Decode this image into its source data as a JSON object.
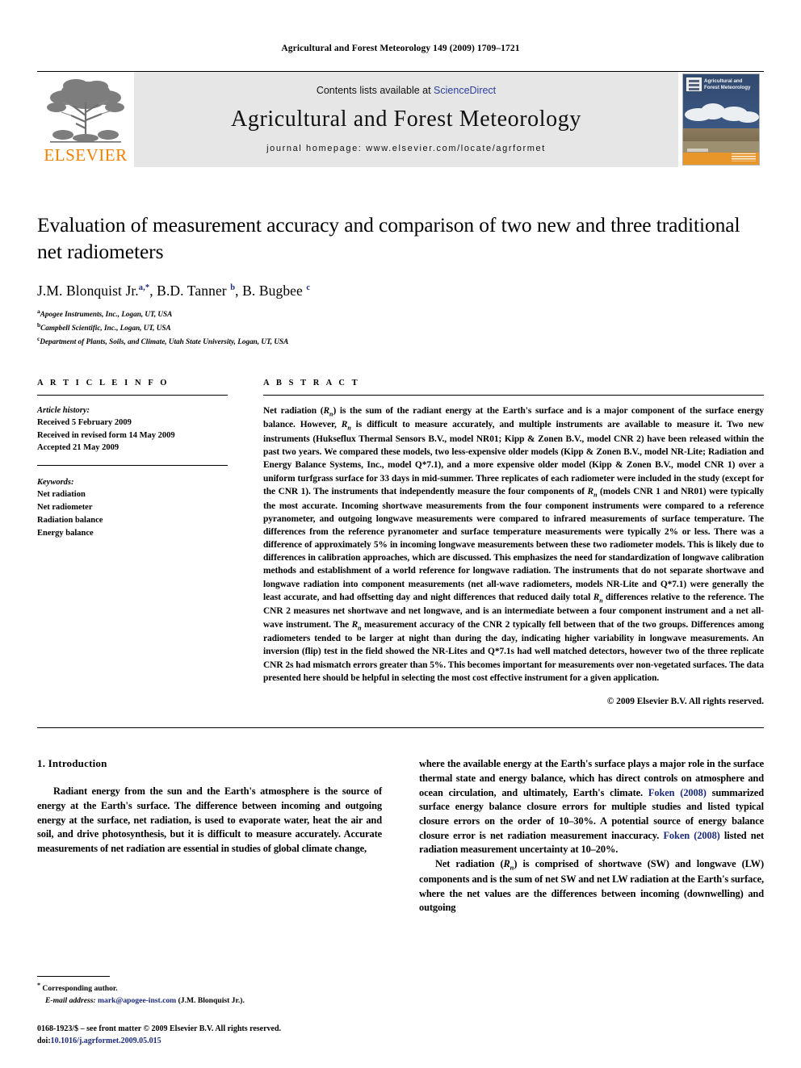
{
  "running_head": "Agricultural and Forest Meteorology 149 (2009) 1709–1721",
  "banner": {
    "publisher_name": "ELSEVIER",
    "contents_prefix": "Contents lists available at ",
    "contents_link": "ScienceDirect",
    "journal_title": "Agricultural and Forest Meteorology",
    "homepage_line": "journal homepage: www.elsevier.com/locate/agrformet",
    "cover_title": "Agricultural and Forest Meteorology"
  },
  "article": {
    "title": "Evaluation of measurement accuracy and comparison of two new and three traditional net radiometers",
    "authors_html": "J.M. Blonquist Jr.<sup>a,*</sup>, B.D. Tanner <sup>b</sup>, B. Bugbee <sup>c</sup>",
    "affiliations": [
      "Apogee Instruments, Inc., Logan, UT, USA",
      "Campbell Scientific, Inc., Logan, UT, USA",
      "Department of Plants, Soils, and Climate, Utah State University, Logan, UT, USA"
    ],
    "affiliation_marks": [
      "a",
      "b",
      "c"
    ]
  },
  "info": {
    "heading": "A R T I C L E  I N F O",
    "history_label": "Article history:",
    "history": [
      "Received 5 February 2009",
      "Received in revised form 14 May 2009",
      "Accepted 21 May 2009"
    ],
    "keywords_label": "Keywords:",
    "keywords": [
      "Net radiation",
      "Net radiometer",
      "Radiation balance",
      "Energy balance"
    ]
  },
  "abstract": {
    "heading": "A B S T R A C T",
    "text_html": "Net radiation (<i>R<sub>n</sub></i>) is the sum of the radiant energy at the Earth's surface and is a major component of the surface energy balance. However, <i>R<sub>n</sub></i> is difficult to measure accurately, and multiple instruments are available to measure it. Two new instruments (Hukseflux Thermal Sensors B.V., model NR01; Kipp &amp; Zonen B.V., model CNR 2) have been released within the past two years. We compared these models, two less-expensive older models (Kipp &amp; Zonen B.V., model NR-Lite; Radiation and Energy Balance Systems, Inc., model Q*7.1), and a more expensive older model (Kipp &amp; Zonen B.V., model CNR 1) over a uniform turfgrass surface for 33 days in mid-summer. Three replicates of each radiometer were included in the study (except for the CNR 1). The instruments that independently measure the four components of <i>R<sub>n</sub></i> (models CNR 1 and NR01) were typically the most accurate. Incoming shortwave measurements from the four component instruments were compared to a reference pyranometer, and outgoing longwave measurements were compared to infrared measurements of surface temperature. The differences from the reference pyranometer and surface temperature measurements were typically 2% or less. There was a difference of approximately 5% in incoming longwave measurements between these two radiometer models. This is likely due to differences in calibration approaches, which are discussed. This emphasizes the need for standardization of longwave calibration methods and establishment of a world reference for longwave radiation. The instruments that do not separate shortwave and longwave radiation into component measurements (net all-wave radiometers, models NR-Lite and Q*7.1) were generally the least accurate, and had offsetting day and night differences that reduced daily total <i>R<sub>n</sub></i> differences relative to the reference. The CNR 2 measures net shortwave and net longwave, and is an intermediate between a four component instrument and a net all-wave instrument. The <i>R<sub>n</sub></i> measurement accuracy of the CNR 2 typically fell between that of the two groups. Differences among radiometers tended to be larger at night than during the day, indicating higher variability in longwave measurements. An inversion (flip) test in the field showed the NR-Lites and Q*7.1s had well matched detectors, however two of the three replicate CNR 2s had mismatch errors greater than 5%. This becomes important for measurements over non-vegetated surfaces. The data presented here should be helpful in selecting the most cost effective instrument for a given application.",
    "copyright": "© 2009 Elsevier B.V. All rights reserved."
  },
  "introduction": {
    "heading": "1. Introduction",
    "left_paragraph_html": "Radiant energy from the sun and the Earth's atmosphere is the source of energy at the Earth's surface. The difference between incoming and outgoing energy at the surface, net radiation, is used to evaporate water, heat the air and soil, and drive photosynthesis, but it is difficult to measure accurately. Accurate measurements of net radiation are essential in studies of global climate change,",
    "right_paragraph_1_html": "where the available energy at the Earth's surface plays a major role in the surface thermal state and energy balance, which has direct controls on atmosphere and ocean circulation, and ultimately, Earth's climate. <span class=\"cite\">Foken (2008)</span> summarized surface energy balance closure errors for multiple studies and listed typical closure errors on the order of 10–30%. A potential source of energy balance closure error is net radiation measurement inaccuracy. <span class=\"cite\">Foken (2008)</span> listed net radiation measurement uncertainty at 10–20%.",
    "right_paragraph_2_html": "Net radiation (<i>R<sub>n</sub></i>) is comprised of shortwave (SW) and longwave (LW) components and is the sum of net SW and net LW radiation at the Earth's surface, where the net values are the differences between incoming (downwelling) and outgoing"
  },
  "footnote": {
    "corresponding_star": "*",
    "corresponding_label": "Corresponding author.",
    "email_label": "E-mail address:",
    "email": "mark@apogee-inst.com",
    "email_suffix": "(J.M. Blonquist Jr.)."
  },
  "imprint": {
    "line1_html": "0168-1923/$ – see front matter © 2009 Elsevier B.V. All rights reserved.",
    "doi_label": "doi:",
    "doi_value": "10.1016/j.agrformet.2009.05.015"
  },
  "colors": {
    "link_blue": "#1b2a7a",
    "sciencedirect_blue": "#2b3fa0",
    "elsevier_orange": "#F08000",
    "banner_grey": "#e6e6e6"
  }
}
